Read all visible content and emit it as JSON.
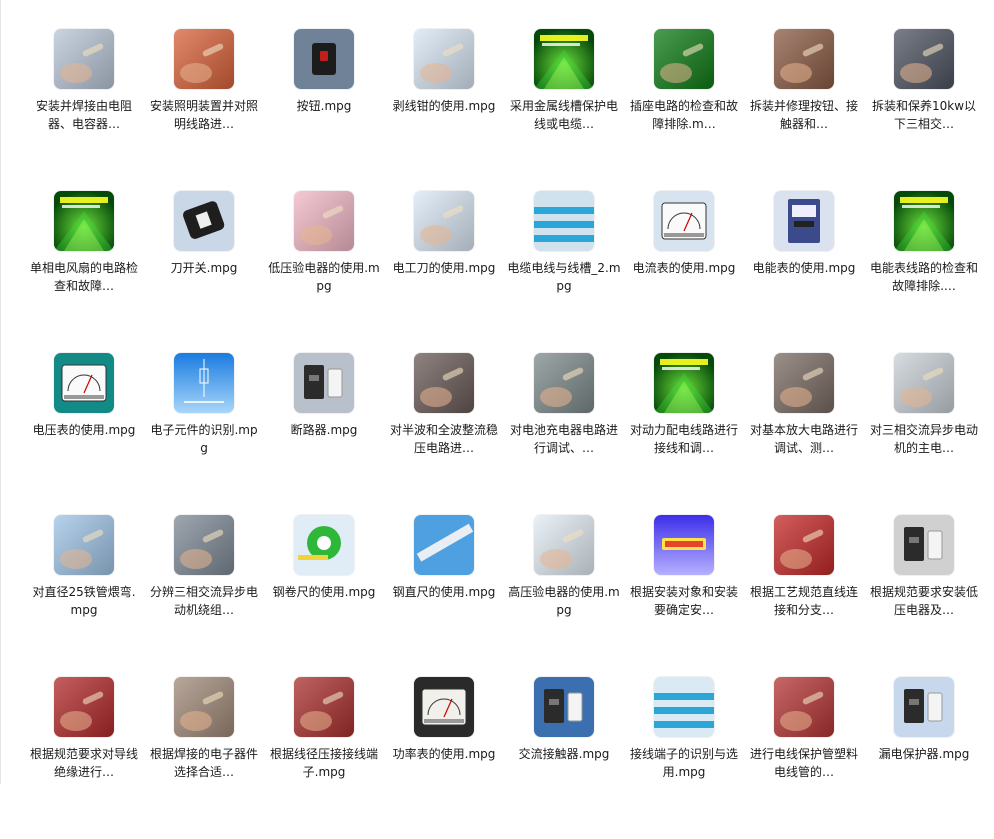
{
  "files": [
    {
      "name": "安装并焊接由电阻器、电容器…",
      "icon": "resistor-soldering-video-icon",
      "bg": "#b9c6d6"
    },
    {
      "name": "安装照明装置并对照明线路进…",
      "icon": "lighting-installation-video-icon",
      "bg": "#d9623a"
    },
    {
      "name": "按钮.mpg",
      "icon": "push-button-video-icon",
      "bg": "#6f8298"
    },
    {
      "name": "剥线钳的使用.mpg",
      "icon": "wire-stripper-video-icon",
      "bg": "#d7e6f4"
    },
    {
      "name": "采用金属线槽保护电线或电缆…",
      "icon": "green-title-slide-icon",
      "bg": "#0c6a12"
    },
    {
      "name": "插座电路的检查和故障排除.m…",
      "icon": "socket-circuit-video-icon",
      "bg": "#0f7a16"
    },
    {
      "name": "拆装并修理按钮、接触器和…",
      "icon": "button-repair-video-icon",
      "bg": "#8a5a44"
    },
    {
      "name": "拆装和保养10kw以下三相交…",
      "icon": "motor-maintenance-video-icon",
      "bg": "#4d5360"
    },
    {
      "name": "单相电风扇的电路检查和故障…",
      "icon": "green-title-slide-icon",
      "bg": "#0c6a12"
    },
    {
      "name": "刀开关.mpg",
      "icon": "knife-switch-video-icon",
      "bg": "#c9d7e6"
    },
    {
      "name": "低压验电器的使用.mpg",
      "icon": "voltage-tester-video-icon",
      "bg": "#f2b8c6"
    },
    {
      "name": "电工刀的使用.mpg",
      "icon": "electrician-knife-video-icon",
      "bg": "#dbe8f6"
    },
    {
      "name": "电缆电线与线槽_2.mpg",
      "icon": "cable-trunking-video-icon",
      "bg": "#cfe2ee"
    },
    {
      "name": "电流表的使用.mpg",
      "icon": "ammeter-video-icon",
      "bg": "#d7e3ef"
    },
    {
      "name": "电能表的使用.mpg",
      "icon": "energy-meter-video-icon",
      "bg": "#d9e2ee"
    },
    {
      "name": "电能表线路的检查和故障排除.…",
      "icon": "green-title-slide-icon",
      "bg": "#0c6a12"
    },
    {
      "name": "电压表的使用.mpg",
      "icon": "voltmeter-video-icon",
      "bg": "#128a86"
    },
    {
      "name": "电子元件的识别.mpg",
      "icon": "component-diagram-video-icon",
      "bg": "#1f8fe0"
    },
    {
      "name": "断路器.mpg",
      "icon": "circuit-breaker-video-icon",
      "bg": "#b8c0cb"
    },
    {
      "name": "对半波和全波整流稳压电路进…",
      "icon": "rectifier-board-video-icon",
      "bg": "#6a5a58"
    },
    {
      "name": "对电池充电器电路进行调试、…",
      "icon": "charger-circuit-video-icon",
      "bg": "#7e8a8a"
    },
    {
      "name": "对动力配电线路进行接线和调…",
      "icon": "green-title-slide-icon",
      "bg": "#0c6a12"
    },
    {
      "name": "对基本放大电路进行调试、测…",
      "icon": "amplifier-test-video-icon",
      "bg": "#7a6a62"
    },
    {
      "name": "对三相交流异步电动机的主电…",
      "icon": "motor-main-circuit-video-icon",
      "bg": "#c8d0d6"
    },
    {
      "name": "对直径25铁管煨弯.mpg",
      "icon": "pipe-bending-video-icon",
      "bg": "#9fc4e6"
    },
    {
      "name": "分辨三相交流异步电动机绕组…",
      "icon": "motor-winding-video-icon",
      "bg": "#7e8a96"
    },
    {
      "name": "钢卷尺的使用.mpg",
      "icon": "tape-measure-video-icon",
      "bg": "#e0ecf6"
    },
    {
      "name": "钢直尺的使用.mpg",
      "icon": "steel-ruler-video-icon",
      "bg": "#4fa0e0"
    },
    {
      "name": "高压验电器的使用.mpg",
      "icon": "high-voltage-tester-video-icon",
      "bg": "#e2ecf4"
    },
    {
      "name": "根据安装对象和安装要确定安…",
      "icon": "purple-title-slide-icon",
      "bg": "#5b3ef0"
    },
    {
      "name": "根据工艺规范直线连接和分支…",
      "icon": "wire-splice-video-icon",
      "bg": "#c42828"
    },
    {
      "name": "根据规范要求安装低压电器及…",
      "icon": "low-voltage-devices-video-icon",
      "bg": "#d0d0d0"
    },
    {
      "name": "根据规范要求对导线绝缘进行…",
      "icon": "wire-insulation-video-icon",
      "bg": "#b22a2a"
    },
    {
      "name": "根据焊接的电子器件选择合适…",
      "icon": "solder-board-video-icon",
      "bg": "#a08a78"
    },
    {
      "name": "根据线径压接接线端子.mpg",
      "icon": "crimp-terminal-video-icon",
      "bg": "#a92e2e"
    },
    {
      "name": "功率表的使用.mpg",
      "icon": "wattmeter-video-icon",
      "bg": "#2a2a2a"
    },
    {
      "name": "交流接触器.mpg",
      "icon": "ac-contactor-video-icon",
      "bg": "#3c6fb0"
    },
    {
      "name": "接线端子的识别与选用.mpg",
      "icon": "terminal-strip-video-icon",
      "bg": "#d9eaf4"
    },
    {
      "name": "进行电线保护管塑料电线管的…",
      "icon": "conduit-video-icon",
      "bg": "#b43434"
    },
    {
      "name": "漏电保护器.mpg",
      "icon": "rcd-breaker-video-icon",
      "bg": "#c8d8ec"
    }
  ]
}
